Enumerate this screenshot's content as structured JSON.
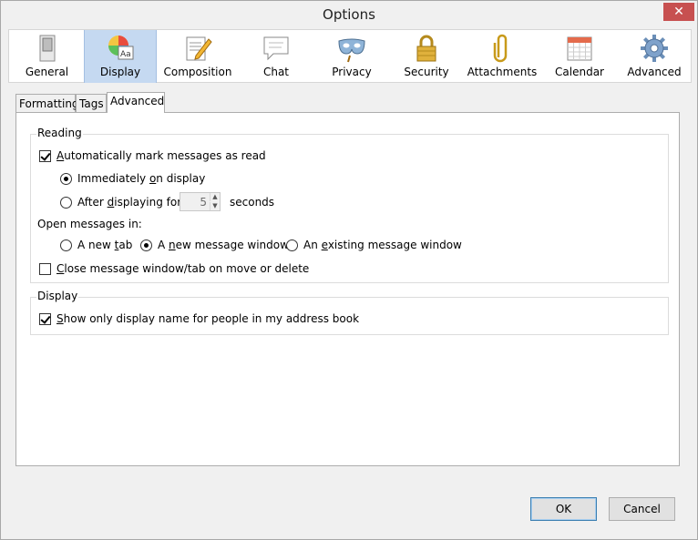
{
  "window": {
    "title": "Options",
    "close_glyph": "✕"
  },
  "toolbar": {
    "items": [
      {
        "label": "General",
        "icon": "switch-icon"
      },
      {
        "label": "Display",
        "icon": "display-palette-icon",
        "active": true
      },
      {
        "label": "Composition",
        "icon": "composition-pencil-icon"
      },
      {
        "label": "Chat",
        "icon": "chat-bubble-icon"
      },
      {
        "label": "Privacy",
        "icon": "privacy-mask-icon"
      },
      {
        "label": "Security",
        "icon": "padlock-icon"
      },
      {
        "label": "Attachments",
        "icon": "paperclip-icon"
      },
      {
        "label": "Calendar",
        "icon": "calendar-icon"
      },
      {
        "label": "Advanced",
        "icon": "gear-icon"
      }
    ]
  },
  "tabs": [
    {
      "label": "Formatting"
    },
    {
      "label": "Tags"
    },
    {
      "label": "Advanced",
      "active": true
    }
  ],
  "reading": {
    "group_label": "Reading",
    "auto_mark": {
      "label_pre": "",
      "label_u": "A",
      "label_post": "utomatically mark messages as read",
      "checked": true
    },
    "immediately": {
      "label_pre": "Immediately ",
      "label_u": "o",
      "label_post": "n display",
      "selected": true
    },
    "after": {
      "label_pre": "After ",
      "label_u": "d",
      "label_post": "isplaying for",
      "selected": false
    },
    "delay_value": "5",
    "seconds_label": "seconds",
    "open_in_label": "Open messages in:",
    "open_tab": {
      "label_pre": "A new ",
      "label_u": "t",
      "label_post": "ab",
      "selected": false
    },
    "open_window": {
      "label_pre": "A ",
      "label_u": "n",
      "label_post": "ew message window",
      "selected": true
    },
    "open_existing": {
      "label_pre": "An ",
      "label_u": "e",
      "label_post": "xisting message window",
      "selected": false
    },
    "close_window": {
      "label_pre": "",
      "label_u": "C",
      "label_post": "lose message window/tab on move or delete",
      "checked": false
    }
  },
  "display": {
    "group_label": "Display",
    "show_name": {
      "label_pre": "",
      "label_u": "S",
      "label_post": "how only display name for people in my address book",
      "checked": true
    }
  },
  "buttons": {
    "ok": "OK",
    "cancel": "Cancel"
  },
  "colors": {
    "active_tool_bg": "#c5d9f1",
    "close_bg": "#c75050",
    "default_btn_border": "#3c7fb1"
  }
}
